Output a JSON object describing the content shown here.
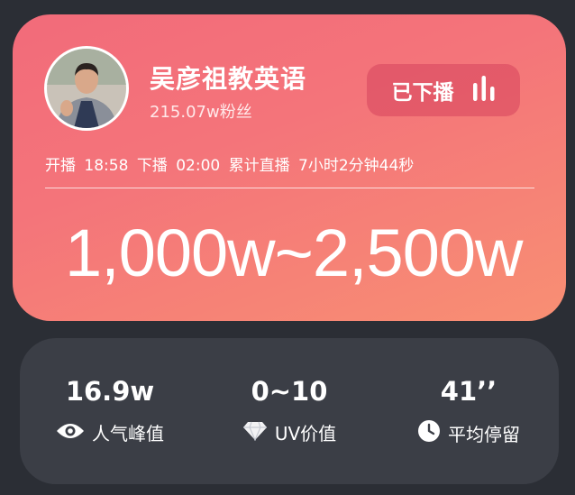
{
  "streamer": {
    "name": "吴彦祖教英语",
    "fans": "215.07w粉丝"
  },
  "status_button": {
    "label": "已下播",
    "icon": "live-bars-icon"
  },
  "timeline": {
    "start_label": "开播",
    "start_time": "18:58",
    "end_label": "下播",
    "end_time": "02:00",
    "duration_label": "累计直播",
    "duration": "7小时2分钟44秒"
  },
  "sales_range": "1,000w~2,500w",
  "stats": [
    {
      "value": "16.9w",
      "label": "人气峰值",
      "icon": "eye-icon"
    },
    {
      "value": "0~10",
      "label": "UV价值",
      "icon": "diamond-icon"
    },
    {
      "value": "41’’",
      "label": "平均停留",
      "icon": "clock-icon"
    }
  ],
  "colors": {
    "background": "#2b2e35",
    "card_gradient_start": "#f26b7a",
    "card_gradient_end": "#f88f73",
    "stats_card": "#3b3e46"
  }
}
